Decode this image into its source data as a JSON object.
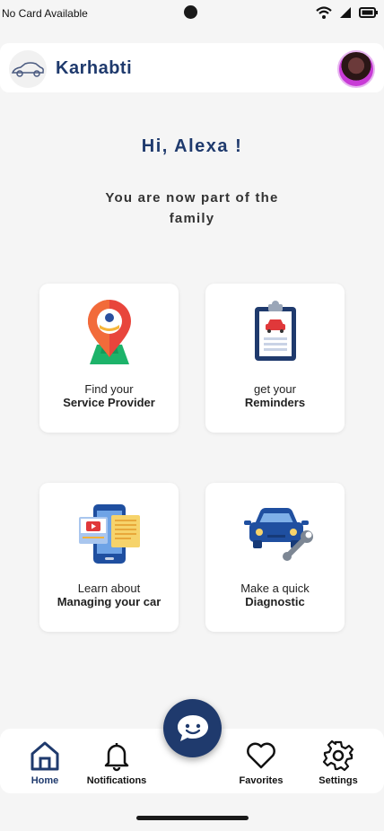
{
  "status_bar": {
    "carrier": "No Card Available"
  },
  "header": {
    "app_title": "Karhabti",
    "logo_icon": "car-logo-icon",
    "avatar_icon": "user-avatar"
  },
  "greeting": "Hi, Alexa !",
  "subtitle": "You are now part of the family",
  "cards": [
    {
      "line1": "Find your",
      "line2": "Service Provider",
      "icon": "map-pin-icon"
    },
    {
      "line1": "get your",
      "line2": "Reminders",
      "icon": "clipboard-icon"
    },
    {
      "line1": "Learn about",
      "line2": "Managing your car",
      "icon": "phone-video-icon"
    },
    {
      "line1": "Make a quick",
      "line2": "Diagnostic",
      "icon": "car-wrench-icon"
    }
  ],
  "bottom_nav": [
    {
      "label": "Home",
      "icon": "home-icon",
      "active": true
    },
    {
      "label": "Notifications",
      "icon": "bell-icon",
      "active": false
    },
    {
      "label": "Favorites",
      "icon": "heart-icon",
      "active": false
    },
    {
      "label": "Settings",
      "icon": "gear-icon",
      "active": false
    }
  ],
  "chat_button": {
    "icon": "chat-bubble-icon"
  },
  "colors": {
    "brand": "#1f3a6d",
    "background": "#f5f5f5",
    "card": "#ffffff"
  }
}
